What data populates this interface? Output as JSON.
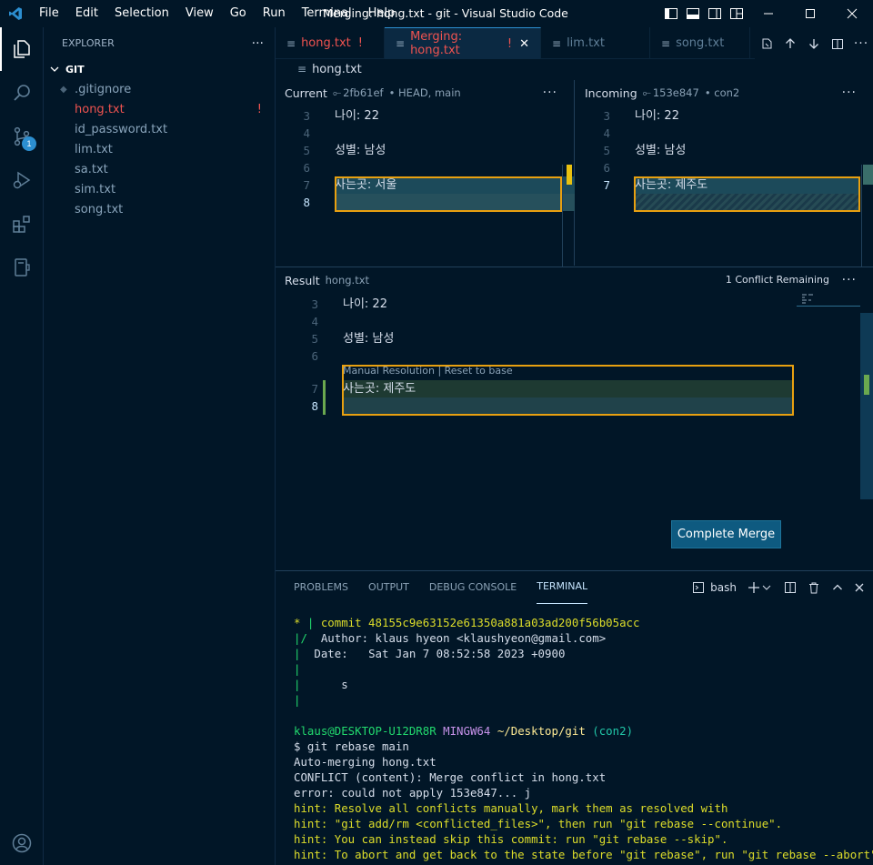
{
  "window_title": "Merging: hong.txt - git - Visual Studio Code",
  "menu": [
    "File",
    "Edit",
    "Selection",
    "View",
    "Go",
    "Run",
    "Terminal",
    "Help"
  ],
  "activity": {
    "scm_badge": "1"
  },
  "sidebar": {
    "title": "EXPLORER",
    "more": "···",
    "folder": "GIT",
    "files": [
      {
        "name": ".gitignore",
        "flag": ""
      },
      {
        "name": "hong.txt",
        "flag": "!"
      },
      {
        "name": "id_password.txt",
        "flag": ""
      },
      {
        "name": "lim.txt",
        "flag": ""
      },
      {
        "name": "sa.txt",
        "flag": ""
      },
      {
        "name": "sim.txt",
        "flag": ""
      },
      {
        "name": "song.txt",
        "flag": ""
      }
    ]
  },
  "tabs": [
    {
      "label": "hong.txt",
      "status": "!"
    },
    {
      "label": "Merging: hong.txt",
      "status": "!",
      "close": "✕"
    },
    {
      "label": "lim.txt"
    },
    {
      "label": "song.txt"
    }
  ],
  "breadcrumb": "hong.txt",
  "current": {
    "label": "Current",
    "commit": "2fb61ef",
    "refs": "• HEAD, main",
    "lines": [
      {
        "n": "3",
        "text": "나이: 22"
      },
      {
        "n": "4",
        "text": ""
      },
      {
        "n": "5",
        "text": "성별: 남성"
      },
      {
        "n": "6",
        "text": ""
      },
      {
        "n": "7",
        "text": "사는곳: 서울"
      },
      {
        "n": "8",
        "text": ""
      }
    ]
  },
  "incoming": {
    "label": "Incoming",
    "commit": "153e847",
    "refs": "• con2",
    "lines": [
      {
        "n": "3",
        "text": "나이: 22"
      },
      {
        "n": "4",
        "text": ""
      },
      {
        "n": "5",
        "text": "성별: 남성"
      },
      {
        "n": "6",
        "text": ""
      },
      {
        "n": "7",
        "text": "사는곳: 제주도"
      }
    ]
  },
  "result": {
    "label": "Result",
    "file": "hong.txt",
    "conflicts": "1 Conflict Remaining",
    "codelens": "Manual Resolution | Reset to base",
    "lines": [
      {
        "n": "3",
        "text": "나이: 22"
      },
      {
        "n": "4",
        "text": ""
      },
      {
        "n": "5",
        "text": "성별: 남성"
      },
      {
        "n": "6",
        "text": ""
      },
      {
        "n": "7",
        "text": "사는곳: 제주도"
      },
      {
        "n": "8",
        "text": ""
      }
    ]
  },
  "complete_merge": "Complete Merge",
  "panel": {
    "tabs": [
      "PROBLEMS",
      "OUTPUT",
      "DEBUG CONSOLE",
      "TERMINAL"
    ],
    "shell": "bash"
  },
  "terminal": {
    "l1_star": "* ",
    "l1_bar": "| ",
    "l1_commit": "commit 48155c9e63152e61350a881a03ad200f56b05acc",
    "l2_bar": "|/ ",
    "l2_text": " Author: klaus hyeon <klaushyeon@gmail.com>",
    "l3_text": "  Date:   Sat Jan 7 08:52:58 2023 +0900",
    "bar": "|",
    "l5_text": "      s",
    "prompt_user": "klaus@DESKTOP-U12DR8R",
    "prompt_env": "MINGW64",
    "prompt_path": "~/Desktop/git",
    "prompt_branch": "(con2)",
    "cmd": "$ git rebase main",
    "out1": "Auto-merging hong.txt",
    "out2": "CONFLICT (content): Merge conflict in hong.txt",
    "out3": "error: could not apply 153e847... j",
    "hint1": "hint: Resolve all conflicts manually, mark them as resolved with",
    "hint2": "hint: \"git add/rm <conflicted_files>\", then run \"git rebase --continue\".",
    "hint3": "hint: You can instead skip this commit: run \"git rebase --skip\".",
    "hint4": "hint: To abort and get back to the state before \"git rebase\", run \"git rebase --abort\"."
  }
}
